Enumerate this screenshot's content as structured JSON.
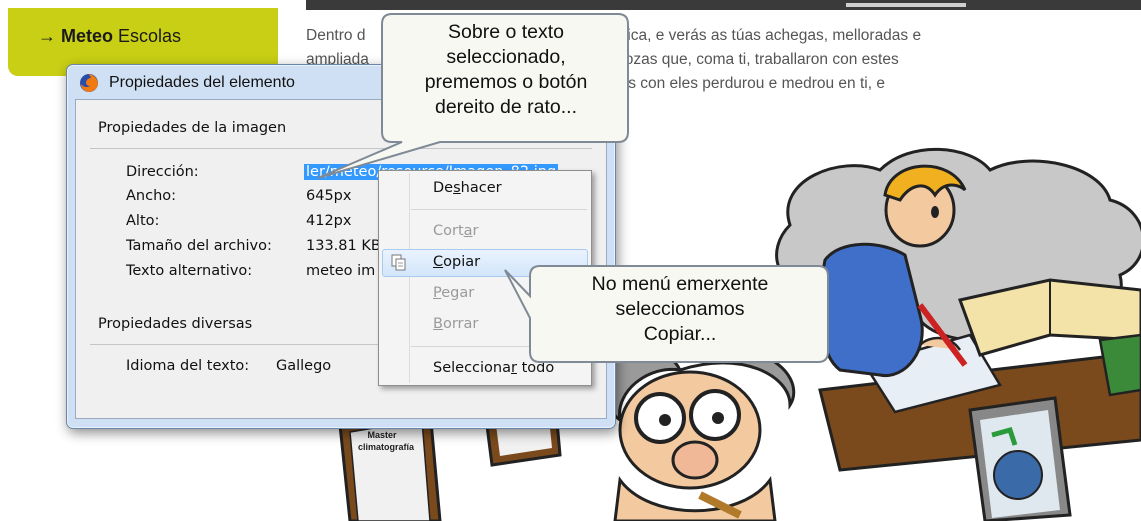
{
  "nav": {
    "arrow": "→",
    "strong": "Meteo",
    "rest": " Escolas"
  },
  "page_text": {
    "line1": "Dentro d                                    web de Climántica, e verás as túas achegas, melloradas e",
    "line2": "ampliada                                     os mozos e mozas que, coma ti, traballaron con estes",
    "line3": "                                               o que aprendiches con eles perdurou e medrou en ti, e"
  },
  "dialog": {
    "title": "Propiedades del elemento",
    "group_image": "Propiedades de la imagen",
    "props": [
      {
        "label": "Dirección:",
        "value": "ler/meteo/resource/Imagen_82.jpg"
      },
      {
        "label": "Ancho:",
        "value": "645px"
      },
      {
        "label": "Alto:",
        "value": "412px"
      },
      {
        "label": "Tamaño del archivo:",
        "value": "133.81 KB"
      },
      {
        "label": "Texto alternativo:",
        "value": "meteo im"
      }
    ],
    "group_misc": "Propiedades diversas",
    "lang_label": "Idioma del texto:",
    "lang_value": "Gallego"
  },
  "context_menu": {
    "items": [
      {
        "label": "Deshacer",
        "state": "normal"
      },
      {
        "label": "Cortar",
        "state": "disabled"
      },
      {
        "label": "Copiar",
        "state": "highlighted",
        "icon": "copy-icon"
      },
      {
        "label": "Pegar",
        "state": "disabled"
      },
      {
        "label": "Borrar",
        "state": "disabled"
      },
      {
        "label": "Seleccionar todo",
        "state": "normal"
      }
    ]
  },
  "callout_top": {
    "lines": [
      "Sobre o texto",
      "seleccionado,",
      "prememos o botón",
      "dereito de rato..."
    ]
  },
  "callout_bottom": {
    "lines": [
      "No menú emerxente",
      "seleccionamos",
      "Copiar..."
    ]
  },
  "cartoon": {
    "diploma_line1": "Master",
    "diploma_line2": "climatografía"
  },
  "colors": {
    "nav_tab": "#c9cf14",
    "selection": "#3399ff",
    "dialog_frame": "#cfe0f4",
    "callout_fill": "#f7f8f2"
  }
}
